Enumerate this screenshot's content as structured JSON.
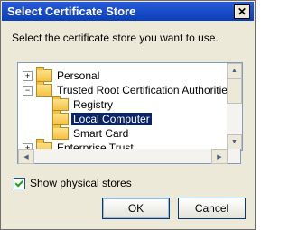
{
  "window": {
    "title": "Select Certificate Store"
  },
  "prompt": "Select the certificate store you want to use.",
  "tree": {
    "items": [
      {
        "label": "Personal",
        "expander": "+",
        "selected": false
      },
      {
        "label": "Trusted Root Certification Authorities",
        "expander": "−",
        "selected": false
      },
      {
        "label": "Registry",
        "selected": false
      },
      {
        "label": "Local Computer",
        "selected": true
      },
      {
        "label": "Smart Card",
        "selected": false
      },
      {
        "label": "Enterprise Trust",
        "expander": "+",
        "selected": false
      }
    ]
  },
  "checkbox": {
    "label": "Show physical stores",
    "checked": true
  },
  "buttons": {
    "ok": "OK",
    "cancel": "Cancel"
  },
  "icons": {
    "close": "close-icon",
    "folder": "folder-icon",
    "scroll_up": "up-arrow-icon",
    "scroll_down": "down-arrow-icon",
    "scroll_left": "left-arrow-icon",
    "scroll_right": "right-arrow-icon",
    "checkmark": "checkmark-icon"
  },
  "colors": {
    "title_bar": "#0a3fb8",
    "selection": "#0a246a",
    "dialog_bg": "#ece9d8"
  }
}
